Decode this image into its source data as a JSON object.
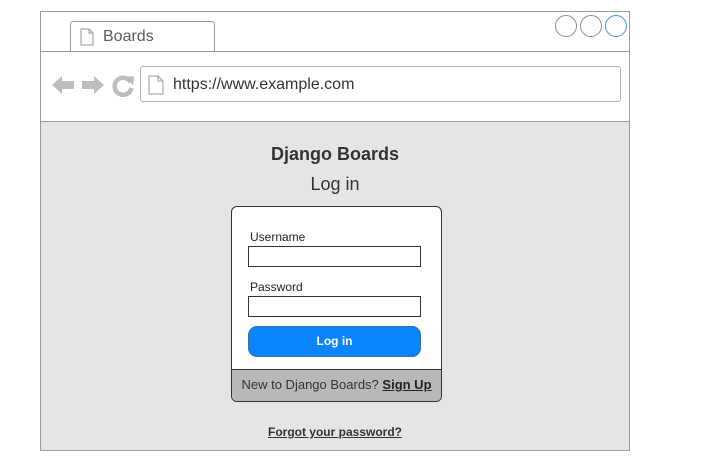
{
  "browser": {
    "tab_title": "Boards",
    "url": "https://www.example.com",
    "icons": {
      "back": "arrow-left-icon",
      "forward": "arrow-right-icon",
      "reload": "reload-icon",
      "page": "page-icon"
    }
  },
  "page": {
    "brand": "Django Boards",
    "title": "Log in",
    "form": {
      "username_label": "Username",
      "username_value": "",
      "password_label": "Password",
      "password_value": "",
      "submit_label": "Log in"
    },
    "footer": {
      "prompt": "New to Django Boards? ",
      "signup_label": "Sign Up"
    },
    "forgot_label": "Forgot your password?"
  },
  "colors": {
    "primary_button": "#0a84ff",
    "content_background": "#e5e5e5",
    "footer_background": "#b8b8b8",
    "active_window_control": "#3b99e8"
  }
}
